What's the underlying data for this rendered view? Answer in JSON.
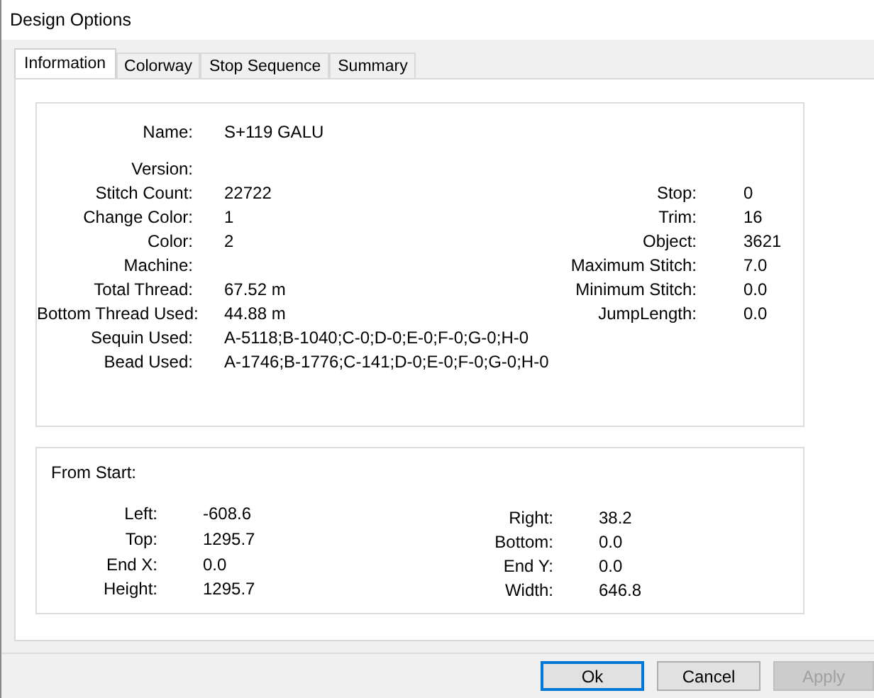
{
  "window": {
    "title": "Design Options"
  },
  "tabs": [
    {
      "label": "Information",
      "selected": true
    },
    {
      "label": "Colorway",
      "selected": false
    },
    {
      "label": "Stop Sequence",
      "selected": false
    },
    {
      "label": "Summary",
      "selected": false
    }
  ],
  "info": {
    "name": {
      "label": "Name:",
      "value": "S+119 GALU"
    },
    "rows": [
      {
        "label": "Version:"
      },
      {
        "label": "Stitch Count:",
        "value": "22722",
        "right": {
          "label": "Stop:",
          "value": "0"
        }
      },
      {
        "label": "Change Color:",
        "value": "1",
        "right": {
          "label": "Trim:",
          "value": "16"
        }
      },
      {
        "label": "Color:",
        "value": "2",
        "right": {
          "label": "Object:",
          "value": "3621"
        }
      },
      {
        "label": "Machine:",
        "right": {
          "label": "Maximum Stitch:",
          "value": "7.0"
        }
      },
      {
        "label": "Total Thread:",
        "value": "67.52 m",
        "right": {
          "label": "Minimum Stitch:",
          "value": "0.0"
        }
      },
      {
        "label": "Bottom Thread Used:",
        "value": "44.88 m",
        "right": {
          "label": "JumpLength:",
          "value": "0.0"
        }
      },
      {
        "label": "Sequin Used:",
        "value": "A-5118;B-1040;C-0;D-0;E-0;F-0;G-0;H-0"
      },
      {
        "label": "Bead Used:",
        "value": "A-1746;B-1776;C-141;D-0;E-0;F-0;G-0;H-0"
      }
    ]
  },
  "from_start": {
    "title": "From Start:",
    "left": [
      {
        "label": "Left:",
        "value": "-608.6"
      },
      {
        "label": "Top:",
        "value": "1295.7"
      },
      {
        "label": "End X:",
        "value": "0.0"
      },
      {
        "label": "Height:",
        "value": "1295.7"
      }
    ],
    "right": [
      {
        "label": "Right:",
        "value": "38.2"
      },
      {
        "label": "Bottom:",
        "value": "0.0"
      },
      {
        "label": "End Y:",
        "value": "0.0"
      },
      {
        "label": "Width:",
        "value": "646.8"
      }
    ]
  },
  "buttons": [
    {
      "label": "Ok",
      "default": true,
      "disabled": false
    },
    {
      "label": "Cancel",
      "default": false,
      "disabled": false
    },
    {
      "label": "Apply",
      "default": false,
      "disabled": true
    }
  ]
}
